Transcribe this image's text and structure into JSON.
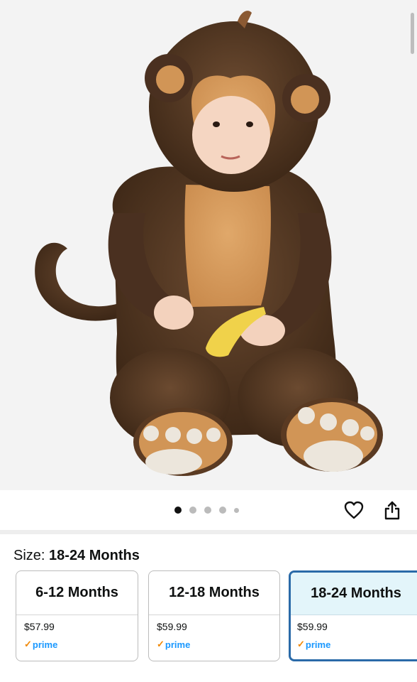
{
  "gallery": {
    "image_alt": "Toddler in brown monkey costume holding a banana",
    "dots_count": 5,
    "active_dot": 0
  },
  "actions": {
    "wishlist_icon": "heart-icon",
    "share_icon": "share-icon"
  },
  "size": {
    "label": "Size: ",
    "selected": "18-24 Months"
  },
  "options": [
    {
      "name": "6-12 Months",
      "price": "$57.99",
      "prime": "prime",
      "selected": false
    },
    {
      "name": "12-18 Months",
      "price": "$59.99",
      "prime": "prime",
      "selected": false
    },
    {
      "name": "18-24 Months",
      "price": "$59.99",
      "prime": "prime",
      "selected": true
    }
  ],
  "colors": {
    "selected_border": "#2a6aa8",
    "selected_bg": "#e3f5fa",
    "prime_blue": "#1a98ff",
    "prime_check": "#f08804"
  }
}
